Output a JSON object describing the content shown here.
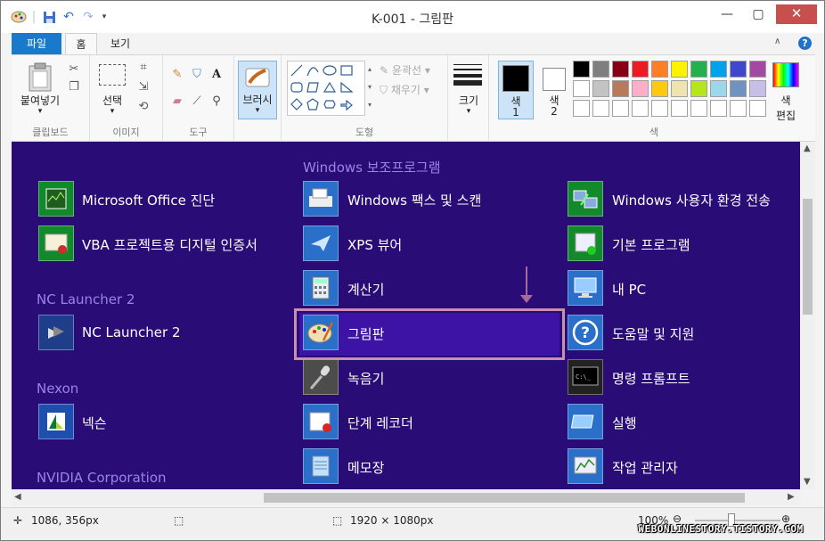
{
  "window": {
    "title": "K-001 - 그림판",
    "minimize_icon": "minimize-icon",
    "maximize_icon": "maximize-icon",
    "close_glyph": "✕"
  },
  "ribbon_tabs": {
    "file": "파일",
    "home": "홈",
    "view": "보기"
  },
  "ribbon": {
    "clipboard": {
      "paste": "붙여넣기",
      "label": "클립보드"
    },
    "image": {
      "select": "선택",
      "label": "이미지"
    },
    "tools": {
      "label": "도구"
    },
    "brushes": {
      "label": "브러시"
    },
    "shapes": {
      "outline": "윤곽선",
      "fill": "채우기",
      "label": "도형"
    },
    "size": {
      "label": "크기"
    },
    "colors": {
      "color1_label": "색",
      "color1_num": "1",
      "color2_label": "색",
      "color2_num": "2",
      "edit_label_line1": "색",
      "edit_label_line2": "편집",
      "label": "색",
      "color1": "#000000",
      "color2": "#ffffff",
      "palette_row1": [
        "#000000",
        "#7f7f7f",
        "#880015",
        "#ed1c24",
        "#ff7f27",
        "#fff200",
        "#22b14c",
        "#00a2e8",
        "#3f48cc",
        "#a349a4"
      ],
      "palette_row2": [
        "#ffffff",
        "#c3c3c3",
        "#b97a57",
        "#ffaec9",
        "#ffc90e",
        "#efe4b0",
        "#b5e61d",
        "#99d9ea",
        "#7092be",
        "#c8bfe7"
      ],
      "palette_row3": [
        "#ffffff",
        "#ffffff",
        "#ffffff",
        "#ffffff",
        "#ffffff",
        "#ffffff",
        "#ffffff",
        "#ffffff",
        "#ffffff",
        "#ffffff"
      ]
    }
  },
  "canvas": {
    "col_left": {
      "items": [
        {
          "label": "Microsoft Office 진단",
          "icon": "office-diagnostic-icon"
        },
        {
          "label": "VBA 프로젝트용 디지털 인증서",
          "icon": "certificate-icon"
        }
      ],
      "sections": [
        {
          "title": "NC Launcher 2",
          "items": [
            {
              "label": "NC Launcher 2",
              "icon": "nc-launcher-icon"
            }
          ]
        },
        {
          "title": "Nexon",
          "items": [
            {
              "label": "넥슨",
              "icon": "nexon-icon"
            }
          ]
        },
        {
          "title": "NVIDIA Corporation",
          "items": []
        }
      ]
    },
    "col_mid": {
      "title": "Windows 보조프로그램",
      "items": [
        {
          "label": "Windows 팩스 및 스캔",
          "icon": "fax-scan-icon"
        },
        {
          "label": "XPS 뷰어",
          "icon": "xps-viewer-icon"
        },
        {
          "label": "계산기",
          "icon": "calculator-icon"
        },
        {
          "label": "그림판",
          "icon": "paint-icon"
        },
        {
          "label": "녹음기",
          "icon": "microphone-icon"
        },
        {
          "label": "단계 레코더",
          "icon": "steps-recorder-icon"
        },
        {
          "label": "메모장",
          "icon": "notepad-icon"
        }
      ]
    },
    "col_right": {
      "items": [
        {
          "label": "Windows 사용자 환경 전송",
          "icon": "easy-transfer-icon"
        },
        {
          "label": "기본 프로그램",
          "icon": "default-programs-icon"
        },
        {
          "label": "내 PC",
          "icon": "my-pc-icon"
        },
        {
          "label": "도움말 및 지원",
          "icon": "help-support-icon"
        },
        {
          "label": "명령 프롬프트",
          "icon": "command-prompt-icon"
        },
        {
          "label": "실행",
          "icon": "run-icon"
        },
        {
          "label": "작업 관리자",
          "icon": "task-manager-icon"
        }
      ]
    }
  },
  "status": {
    "cursor": "1086, 356px",
    "size": "1920 × 1080px",
    "zoom": "100%"
  },
  "watermark": "WEBONLINESTORY.TISTORY.COM"
}
